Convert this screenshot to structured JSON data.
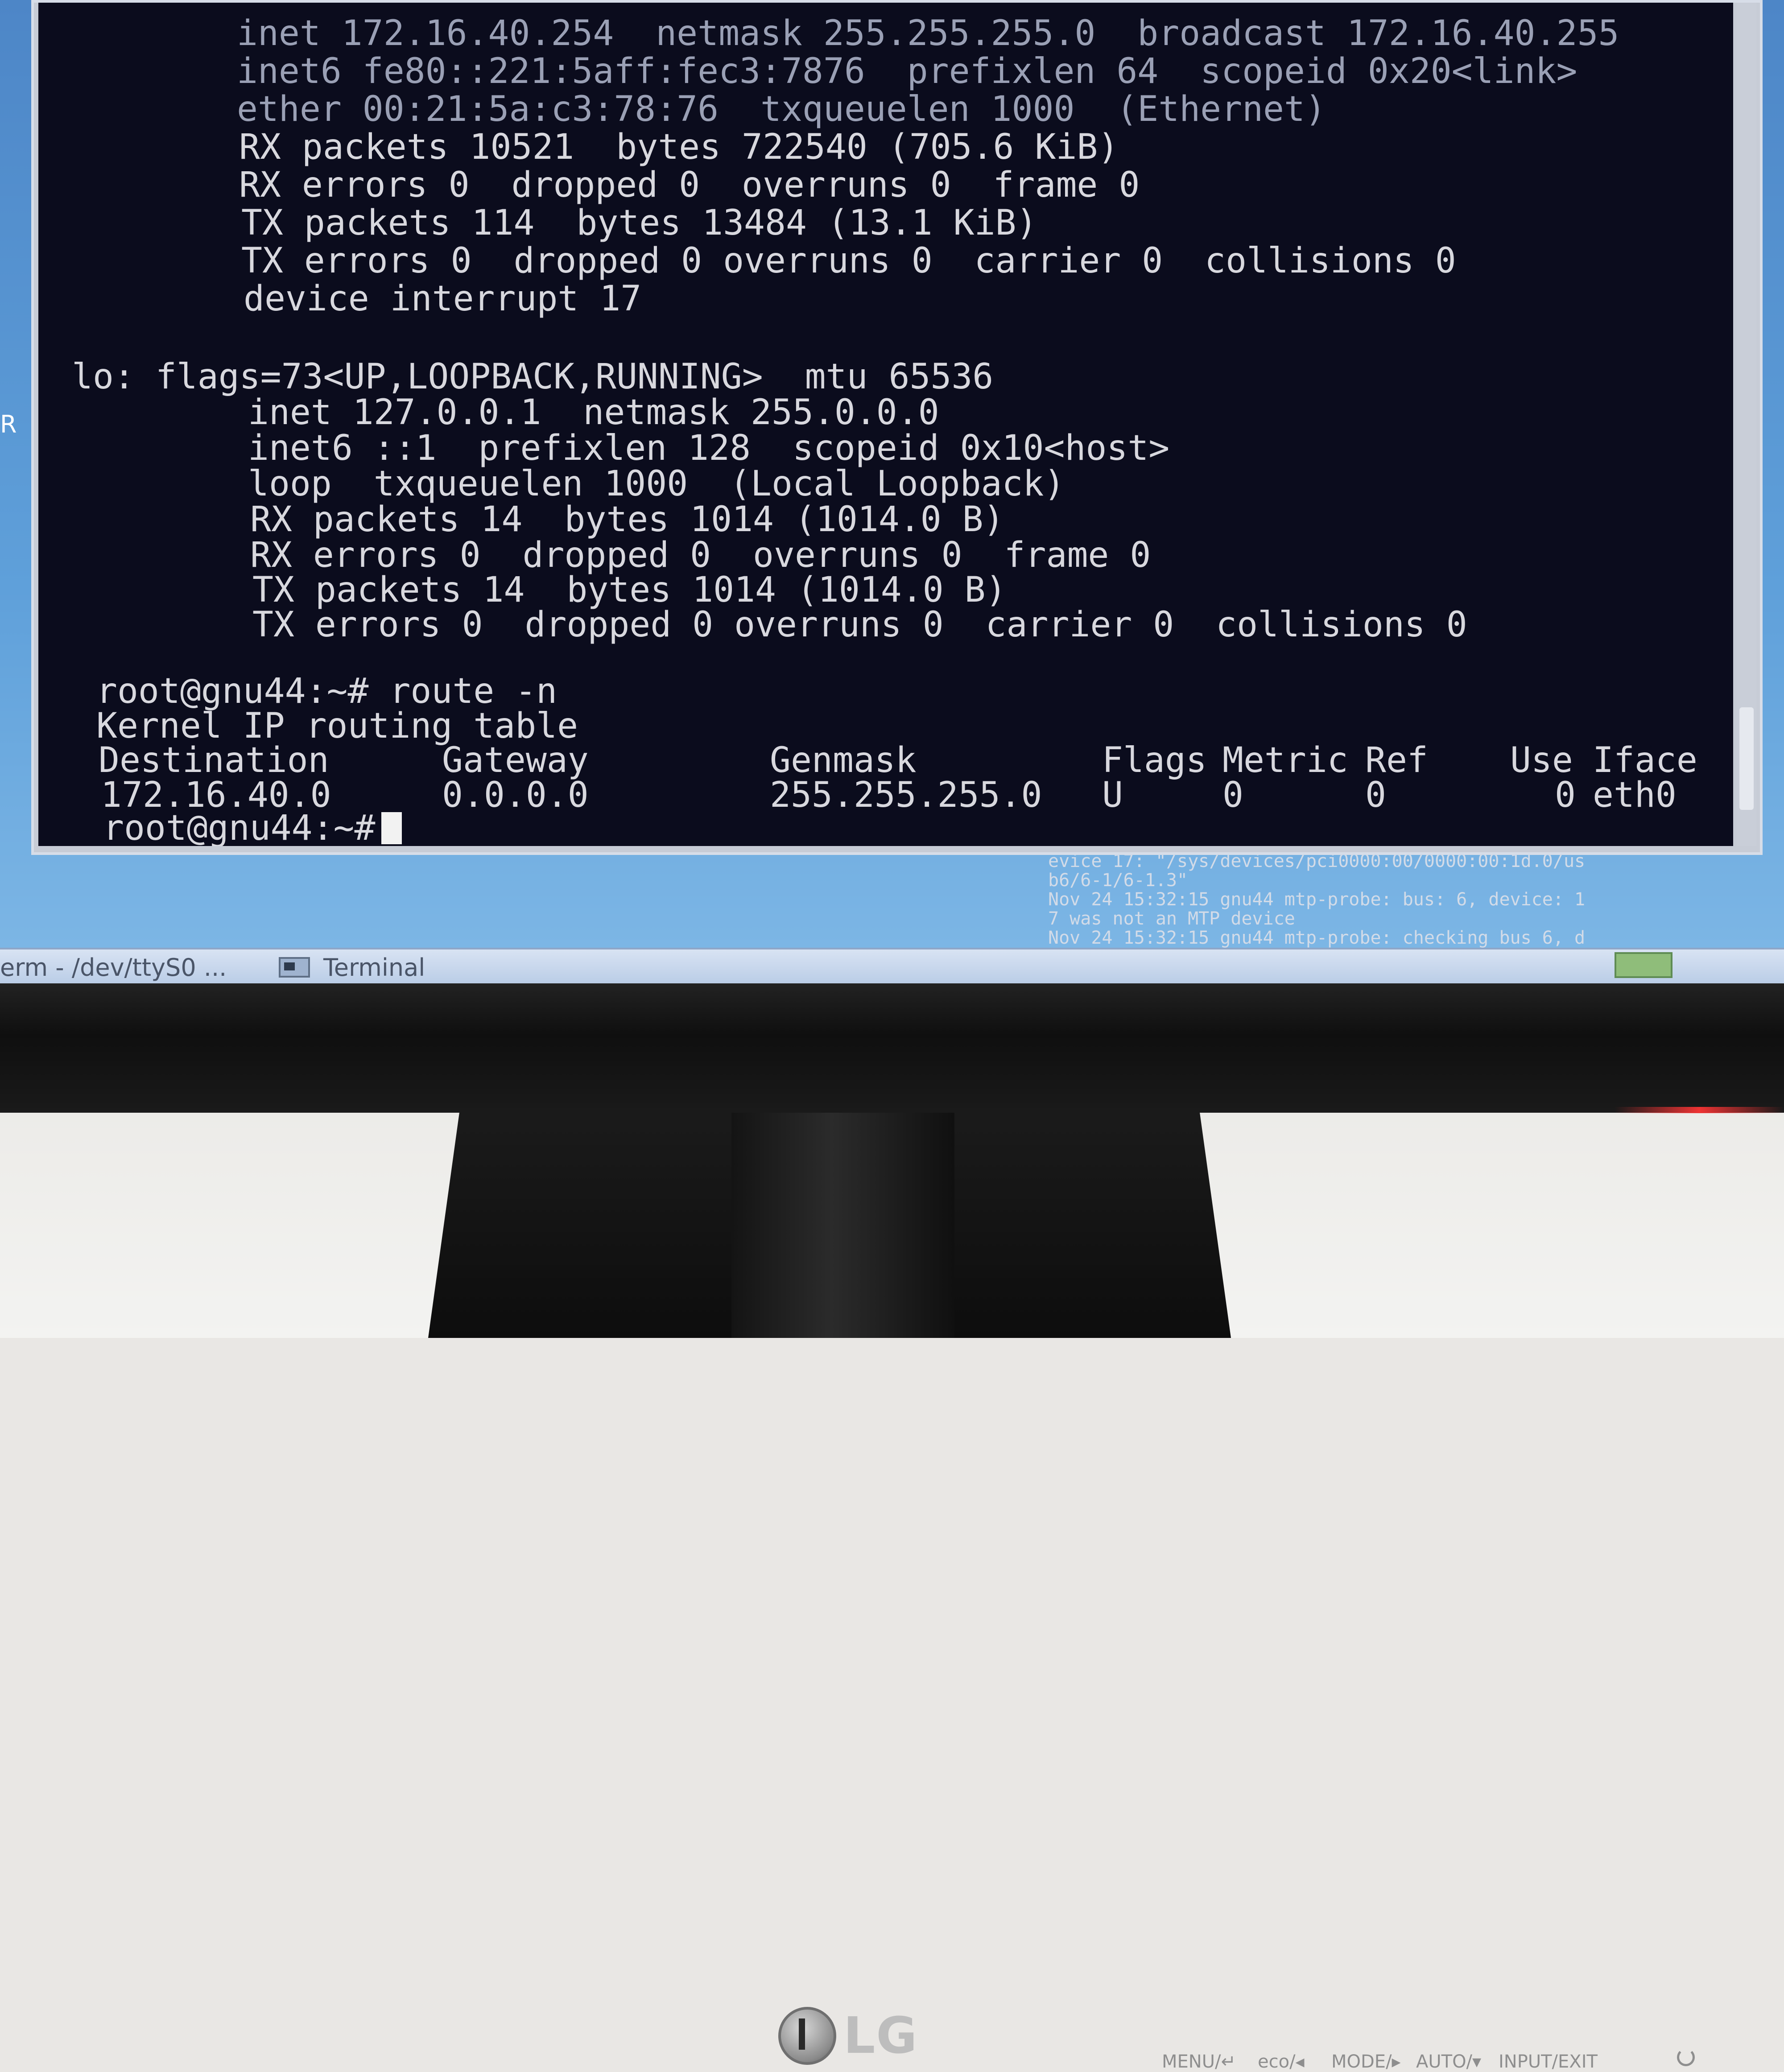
{
  "terminal": {
    "eth_block": [
      "inet 172.16.40.254  netmask 255.255.255.0  broadcast 172.16.40.255",
      "inet6 fe80::221:5aff:fec3:7876  prefixlen 64  scopeid 0x20<link>",
      "ether 00:21:5a:c3:78:76  txqueuelen 1000  (Ethernet)",
      "RX packets 10521  bytes 722540 (705.6 KiB)",
      "RX errors 0  dropped 0  overruns 0  frame 0",
      "TX packets 114  bytes 13484 (13.1 KiB)",
      "TX errors 0  dropped 0 overruns 0  carrier 0  collisions 0",
      "device interrupt 17"
    ],
    "lo_header": "lo: flags=73<UP,LOOPBACK,RUNNING>  mtu 65536",
    "lo_block": [
      "inet 127.0.0.1  netmask 255.0.0.0",
      "inet6 ::1  prefixlen 128  scopeid 0x10<host>",
      "loop  txqueuelen 1000  (Local Loopback)",
      "RX packets 14  bytes 1014 (1014.0 B)",
      "RX errors 0  dropped 0  overruns 0  frame 0",
      "TX packets 14  bytes 1014 (1014.0 B)",
      "TX errors 0  dropped 0 overruns 0  carrier 0  collisions 0"
    ],
    "prompt": "root@gnu44:~#",
    "command": "route -n",
    "route_title": "Kernel IP routing table",
    "route_headers": [
      "Destination",
      "Gateway",
      "Genmask",
      "Flags",
      "Metric",
      "Ref",
      "Use",
      "Iface"
    ],
    "route_row": [
      "172.16.40.0",
      "0.0.0.0",
      "255.255.255.0",
      "U",
      "0",
      "0",
      "0",
      "eth0"
    ]
  },
  "log_lines": [
    "evice 17: \"/sys/devices/pci0000:00/0000:00:1d.0/us",
    "b6/6-1/6-1.3\"",
    "Nov 24 15:32:15 gnu44 mtp-probe: bus: 6, device: 1",
    "7 was not an MTP device",
    "Nov 24 15:32:15 gnu44 mtp-probe: checking bus 6, d"
  ],
  "side_letter": "R",
  "taskbar": {
    "item1": "erm - /dev/ttyS0 ...",
    "item2": "Terminal"
  },
  "monitor": {
    "brand": "LG",
    "controls": {
      "menu": "MENU/↵",
      "eco": "eco/◂",
      "mode": "MODE/▸",
      "auto": "AUTO/▾",
      "input": "INPUT/EXIT"
    }
  },
  "colors": {
    "terminal_bg": "#0b0c1d",
    "terminal_fg": "#d8d8de",
    "desktop": "#5fa0da"
  }
}
